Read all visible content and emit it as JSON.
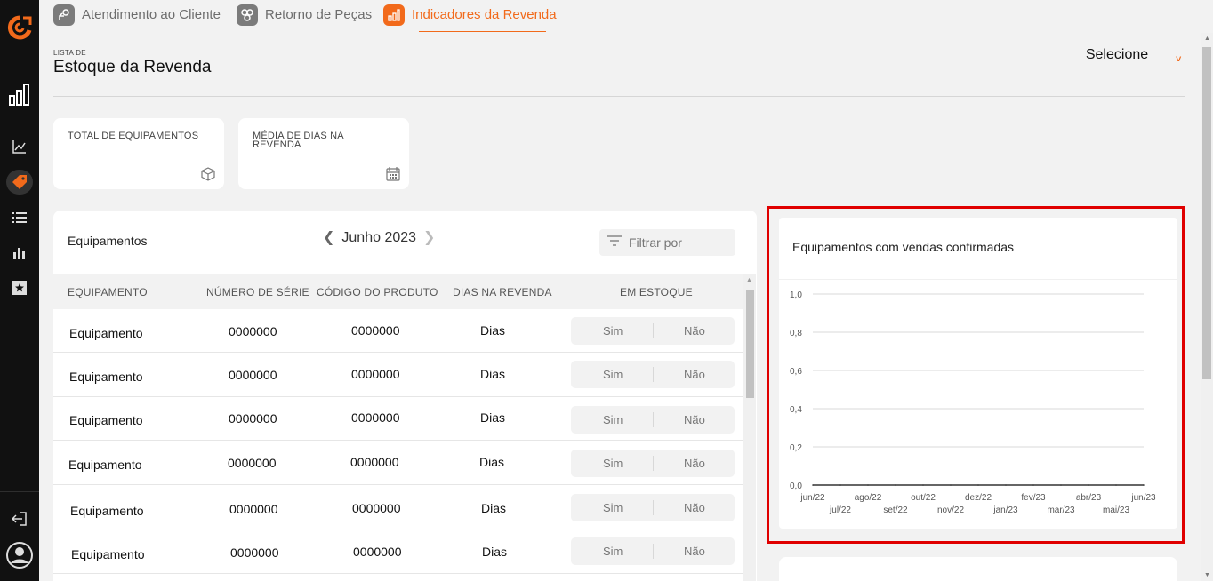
{
  "nav": {
    "tabs": [
      {
        "label": "Atendimento ao Cliente",
        "icon": "customer-service-icon",
        "active": false
      },
      {
        "label": "Retorno de Peças",
        "icon": "parts-return-icon",
        "active": false
      },
      {
        "label": "Indicadores da Revenda",
        "icon": "dealer-indicators-icon",
        "active": true
      }
    ]
  },
  "sidebar": {
    "items": [
      {
        "icon": "bar-chart-icon"
      },
      {
        "icon": "line-chart-icon"
      },
      {
        "icon": "tag-icon",
        "active": true
      },
      {
        "icon": "list-icon"
      },
      {
        "icon": "column-chart-icon"
      },
      {
        "icon": "star-box-icon"
      }
    ],
    "footer": [
      {
        "icon": "logout-icon"
      },
      {
        "icon": "user-avatar-icon"
      }
    ]
  },
  "header": {
    "subtitle": "LISTA DE",
    "title": "Estoque da Revenda",
    "select_value": "Selecione",
    "select_chevron": "˅"
  },
  "summary": [
    {
      "label": "TOTAL DE EQUIPAMENTOS",
      "icon": "cube-icon"
    },
    {
      "label": "MÉDIA DE DIAS NA REVENDA",
      "icon": "calendar-icon"
    }
  ],
  "table": {
    "title": "Equipamentos",
    "month": "Junho 2023",
    "prev": "❮",
    "next": "❯",
    "filter_label": "Filtrar por",
    "columns": [
      "EQUIPAMENTO",
      "NÚMERO DE SÉRIE",
      "CÓDIGO DO PRODUTO",
      "DIAS NA REVENDA",
      "EM ESTOQUE"
    ],
    "rows": [
      {
        "equipamento": "Equipamento",
        "serie": "0000000",
        "codigo": "0000000",
        "dias": "Dias",
        "sim": "Sim",
        "nao": "Não"
      },
      {
        "equipamento": "Equipamento",
        "serie": "0000000",
        "codigo": "0000000",
        "dias": "Dias",
        "sim": "Sim",
        "nao": "Não"
      },
      {
        "equipamento": "Equipamento",
        "serie": "0000000",
        "codigo": "0000000",
        "dias": "Dias",
        "sim": "Sim",
        "nao": "Não"
      },
      {
        "equipamento": "Equipamento",
        "serie": "0000000",
        "codigo": "0000000",
        "dias": "Dias",
        "sim": "Sim",
        "nao": "Não"
      },
      {
        "equipamento": "Equipamento",
        "serie": "0000000",
        "codigo": "0000000",
        "dias": "Dias",
        "sim": "Sim",
        "nao": "Não"
      },
      {
        "equipamento": "Equipamento",
        "serie": "0000000",
        "codigo": "0000000",
        "dias": "Dias",
        "sim": "Sim",
        "nao": "Não"
      }
    ]
  },
  "chart_data": {
    "type": "line",
    "title": "Equipamentos com vendas confirmadas",
    "x": [
      "jun/22",
      "jul/22",
      "ago/22",
      "set/22",
      "out/22",
      "nov/22",
      "dez/22",
      "jan/23",
      "fev/23",
      "mar/23",
      "abr/23",
      "mai/23",
      "jun/23"
    ],
    "series": [
      {
        "values": [
          0,
          0,
          0,
          0,
          0,
          0,
          0,
          0,
          0,
          0,
          0,
          0,
          0
        ]
      }
    ],
    "yticks": [
      "0,0",
      "0,2",
      "0,4",
      "0,6",
      "0,8",
      "1,0"
    ],
    "ylim": [
      0,
      1
    ],
    "grid": true,
    "line_color": "#333333"
  },
  "colors": {
    "accent": "#f26a1b",
    "sidebar": "#111111",
    "highlight": "#e00000"
  }
}
